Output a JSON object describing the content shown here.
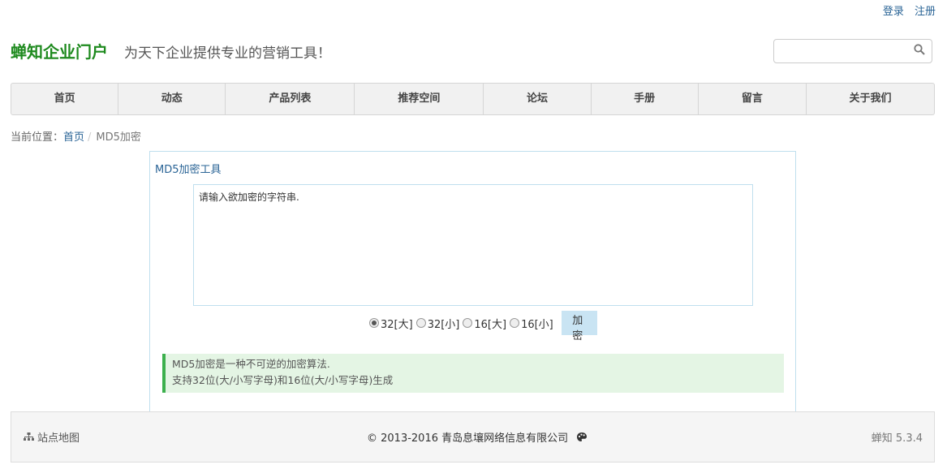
{
  "header": {
    "login": "登录",
    "register": "注册",
    "brand": "蝉知企业门户",
    "slogan": "为天下企业提供专业的营销工具！",
    "search_placeholder": "",
    "brand_color": "#1e8a1e"
  },
  "nav": {
    "items": [
      "首页",
      "动态",
      "产品列表",
      "推荐空间",
      "论坛",
      "手册",
      "留言",
      "关于我们"
    ]
  },
  "breadcrumb": {
    "prefix": "当前位置：",
    "home": "首页",
    "current": "MD5加密"
  },
  "tool": {
    "title": "MD5加密工具",
    "input_value": "请输入欲加密的字符串.",
    "options": [
      "32[大]",
      "32[小]",
      "16[大]",
      "16[小]"
    ],
    "selected_option": "32[大]",
    "encrypt_button": "加 密",
    "note_line1": "MD5加密是一种不可逆的加密算法.",
    "note_line2": "支持32位(大/小写字母)和16位(大/小写字母)生成"
  },
  "footer": {
    "sitemap": "站点地图",
    "copyright": "© 2013-2016 青岛息壤网络信息有限公司",
    "version": "蝉知 5.3.4",
    "sitemap_icon": "sitemap-icon",
    "theme_icon": "palette-icon"
  }
}
